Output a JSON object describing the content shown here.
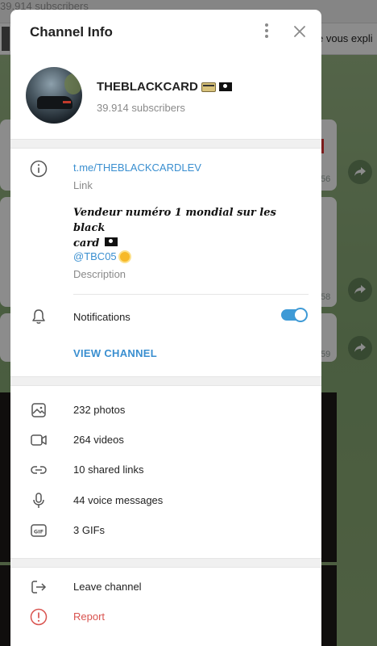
{
  "background": {
    "subscribers_text": "39.914 subscribers",
    "pinned_preview": "e vous expli",
    "times": [
      "56",
      "58",
      "59"
    ]
  },
  "modal": {
    "title": "Channel Info",
    "more_icon": "more-vertical-icon",
    "close_icon": "close-icon",
    "channel_name": "THEBLACKCARD",
    "subscribers": "39.914 subscribers",
    "link": "t.me/THEBLACKCARDLEV",
    "link_label": "Link",
    "description_line1": "Vendeur numéro 1 mondial sur les black",
    "description_line2": "card",
    "mention": "@TBC05",
    "description_label": "Description",
    "notifications_label": "Notifications",
    "notifications_on": true,
    "view_channel": "VIEW CHANNEL",
    "media": [
      {
        "icon": "photo-icon",
        "label": "232 photos"
      },
      {
        "icon": "video-icon",
        "label": "264 videos"
      },
      {
        "icon": "link-icon",
        "label": "10 shared links"
      },
      {
        "icon": "microphone-icon",
        "label": "44 voice messages"
      },
      {
        "icon": "gif-icon",
        "label": "3 GIFs"
      }
    ],
    "actions": [
      {
        "icon": "leave-icon",
        "label": "Leave channel"
      },
      {
        "icon": "report-icon",
        "label": "Report"
      }
    ]
  },
  "colors": {
    "accent": "#3a8fd0",
    "danger": "#d9534f",
    "toggle": "#3e9ad6"
  }
}
